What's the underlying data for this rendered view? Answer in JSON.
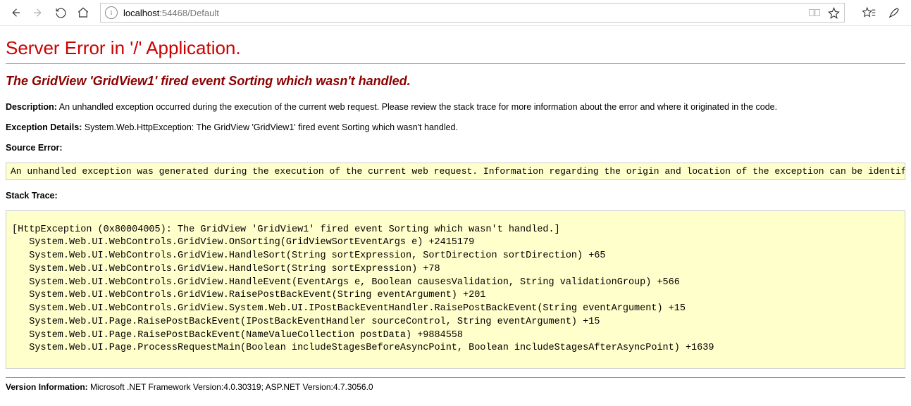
{
  "browser": {
    "address": {
      "host": "localhost",
      "rest": ":54468/Default"
    }
  },
  "page": {
    "title": "Server Error in '/' Application.",
    "subtitle": "The GridView 'GridView1' fired event Sorting which wasn't handled.",
    "description_label": "Description:",
    "description_text": "An unhandled exception occurred during the execution of the current web request. Please review the stack trace for more information about the error and where it originated in the code.",
    "exception_label": "Exception Details:",
    "exception_text": "System.Web.HttpException: The GridView 'GridView1' fired event Sorting which wasn't handled.",
    "source_label": "Source Error:",
    "source_box": "An unhandled exception was generated during the execution of the current web request. Information regarding the origin and location of the exception can be identified using the exception stack trace below.",
    "stack_label": "Stack Trace:",
    "stack_box": "[HttpException (0x80004005): The GridView 'GridView1' fired event Sorting which wasn't handled.]\n   System.Web.UI.WebControls.GridView.OnSorting(GridViewSortEventArgs e) +2415179\n   System.Web.UI.WebControls.GridView.HandleSort(String sortExpression, SortDirection sortDirection) +65\n   System.Web.UI.WebControls.GridView.HandleSort(String sortExpression) +78\n   System.Web.UI.WebControls.GridView.HandleEvent(EventArgs e, Boolean causesValidation, String validationGroup) +566\n   System.Web.UI.WebControls.GridView.RaisePostBackEvent(String eventArgument) +201\n   System.Web.UI.WebControls.GridView.System.Web.UI.IPostBackEventHandler.RaisePostBackEvent(String eventArgument) +15\n   System.Web.UI.Page.RaisePostBackEvent(IPostBackEventHandler sourceControl, String eventArgument) +15\n   System.Web.UI.Page.RaisePostBackEvent(NameValueCollection postData) +9884558\n   System.Web.UI.Page.ProcessRequestMain(Boolean includeStagesBeforeAsyncPoint, Boolean includeStagesAfterAsyncPoint) +1639",
    "version_label": "Version Information:",
    "version_text": "Microsoft .NET Framework Version:4.0.30319; ASP.NET Version:4.7.3056.0"
  }
}
